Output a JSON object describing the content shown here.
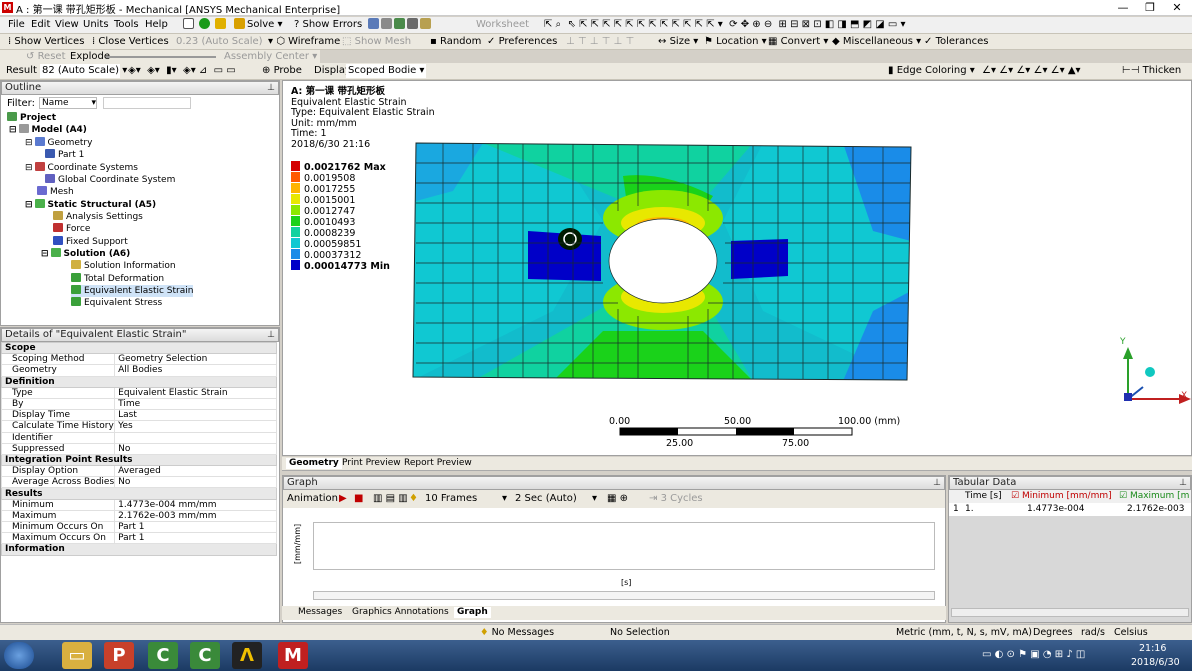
{
  "window": {
    "title": "A : 第一课 带孔矩形板 - Mechanical [ANSYS Mechanical Enterprise]"
  },
  "menu": [
    "File",
    "Edit",
    "View",
    "Units",
    "Tools",
    "Help"
  ],
  "toolbar1": {
    "solve": "Solve",
    "show_errors": "Show Errors",
    "worksheet": "Worksheet"
  },
  "toolbar2": {
    "show_vertices": "Show Vertices",
    "close_vertices": "Close Vertices",
    "auto_scale": "0.23 (Auto Scale)",
    "wireframe": "Wireframe",
    "show_mesh": "Show Mesh",
    "random": "Random",
    "preferences": "Preferences",
    "size": "Size",
    "location": "Location",
    "convert": "Convert",
    "misc": "Miscellaneous",
    "tolerances": "Tolerances"
  },
  "toolbar3": {
    "reset": "Reset",
    "explode": "Explode",
    "assembly_center": "Assembly Center"
  },
  "toolbar4": {
    "result": "Result",
    "scale": "82 (Auto Scale)",
    "probe": "Probe",
    "display": "Display",
    "scoped": "Scoped Bodie",
    "edge_coloring": "Edge Coloring",
    "thicken": "Thicken"
  },
  "outline": {
    "title": "Outline",
    "filter_label": "Filter:",
    "filter_value": "Name",
    "tree": [
      "Project",
      "Model (A4)",
      "Geometry",
      "Part 1",
      "Coordinate Systems",
      "Global Coordinate System",
      "Mesh",
      "Static Structural (A5)",
      "Analysis Settings",
      "Force",
      "Fixed Support",
      "Solution (A6)",
      "Solution Information",
      "Total Deformation",
      "Equivalent Elastic Strain",
      "Equivalent Stress"
    ]
  },
  "details": {
    "title": "Details of \"Equivalent Elastic Strain\"",
    "rows": [
      {
        "s": 1,
        "k": "Scope",
        "v": ""
      },
      {
        "s": 0,
        "k": "Scoping Method",
        "v": "Geometry Selection"
      },
      {
        "s": 0,
        "k": "Geometry",
        "v": "All Bodies"
      },
      {
        "s": 1,
        "k": "Definition",
        "v": ""
      },
      {
        "s": 0,
        "k": "Type",
        "v": "Equivalent Elastic Strain"
      },
      {
        "s": 0,
        "k": "By",
        "v": "Time"
      },
      {
        "s": 0,
        "k": "Display Time",
        "v": "Last"
      },
      {
        "s": 0,
        "k": "Calculate Time History",
        "v": "Yes"
      },
      {
        "s": 0,
        "k": "Identifier",
        "v": ""
      },
      {
        "s": 0,
        "k": "Suppressed",
        "v": "No"
      },
      {
        "s": 1,
        "k": "Integration Point Results",
        "v": ""
      },
      {
        "s": 0,
        "k": "Display Option",
        "v": "Averaged"
      },
      {
        "s": 0,
        "k": "Average Across Bodies",
        "v": "No"
      },
      {
        "s": 1,
        "k": "Results",
        "v": ""
      },
      {
        "s": 0,
        "k": "Minimum",
        "v": "1.4773e-004 mm/mm"
      },
      {
        "s": 0,
        "k": "Maximum",
        "v": "2.1762e-003 mm/mm"
      },
      {
        "s": 0,
        "k": "Minimum Occurs On",
        "v": "Part 1"
      },
      {
        "s": 0,
        "k": "Maximum Occurs On",
        "v": "Part 1"
      },
      {
        "s": 1,
        "k": "Information",
        "v": ""
      }
    ]
  },
  "viewport": {
    "header": "A: 第一课 带孔矩形板",
    "type": "Equivalent Elastic Strain",
    "line2": "Type: Equivalent Elastic Strain",
    "unit": "Unit: mm/mm",
    "time": "Time: 1",
    "date": "2018/6/30 21:16",
    "legend": [
      {
        "v": "0.0021762 Max",
        "c": "#d40000",
        "b": true
      },
      {
        "v": "0.0019508",
        "c": "#ff5a00",
        "b": false
      },
      {
        "v": "0.0017255",
        "c": "#ffb400",
        "b": false
      },
      {
        "v": "0.0015001",
        "c": "#e8e800",
        "b": false
      },
      {
        "v": "0.0012747",
        "c": "#8ce800",
        "b": false
      },
      {
        "v": "0.0010493",
        "c": "#1ad21a",
        "b": false
      },
      {
        "v": "0.0008239",
        "c": "#10d2a0",
        "b": false
      },
      {
        "v": "0.00059851",
        "c": "#10c8d2",
        "b": false
      },
      {
        "v": "0.00037312",
        "c": "#1a8ce8",
        "b": false
      },
      {
        "v": "0.00014773 Min",
        "c": "#0000c8",
        "b": true
      }
    ],
    "scale": {
      "t0": "0.00",
      "t50": "50.00",
      "t100": "100.00 (mm)",
      "t25": "25.00",
      "t75": "75.00"
    },
    "axes": {
      "y": "Y",
      "x": "X"
    },
    "tabs": [
      "Geometry",
      "Print Preview",
      "Report Preview"
    ]
  },
  "graph": {
    "title": "Graph",
    "animation": "Animation",
    "frames": "10 Frames",
    "sec": "2 Sec (Auto)",
    "cycles": "3 Cycles",
    "ylabel": "[mm/mm]",
    "xlabel": "[s]",
    "tabs": [
      "Messages",
      "Graphics Annotations",
      "Graph"
    ]
  },
  "tabular": {
    "title": "Tabular Data",
    "cols": [
      "Time [s]",
      "Minimum [mm/mm]",
      "Maximum [m"
    ],
    "rows": [
      [
        "1",
        "1.",
        "1.4773e-004",
        "2.1762e-003"
      ]
    ]
  },
  "status": {
    "messages": "No Messages",
    "selection": "No Selection",
    "units": "Metric (mm, t, N, s, mV, mA)",
    "degrees": "Degrees",
    "rads": "rad/s",
    "temp": "Celsius"
  },
  "taskbar": {
    "time": "21:16",
    "date": "2018/6/30"
  }
}
